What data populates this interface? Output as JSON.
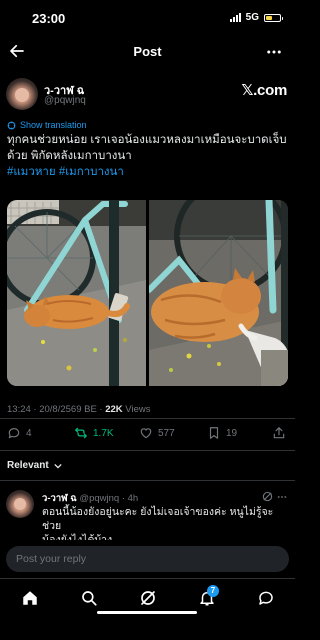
{
  "status_bar": {
    "time": "23:00",
    "network": "5G",
    "battery_color": "#f6d64a"
  },
  "header": {
    "title": "Post"
  },
  "author": {
    "name": "ว-วาฬ ฉ",
    "handle": "@pqwjnq",
    "brand": "𝕏.com"
  },
  "translate": {
    "label": "Show translation"
  },
  "post": {
    "line1": "ทุกคนช่วยหน่อย เราเจอน้องแมวหลงมาเหมือนจะบาดเจ็บ",
    "line2": "ด้วย พิกัดหลังเมกาบางนา",
    "hashtags": [
      "#แมวหาย",
      "#เมกาบางนา"
    ]
  },
  "meta": {
    "timestamp": "13:24 · 20/8/2569 BE · ",
    "views_count": "22K",
    "views_label": " Views"
  },
  "actions": {
    "replies": "4",
    "reposts": "1.7K",
    "likes": "577",
    "bookmarks": "19"
  },
  "sort": {
    "label": "Relevant"
  },
  "reply": {
    "name": "ว-วาฬ ฉ",
    "handle": "@pqwjnq",
    "time": "· 4h",
    "line1": "ตอนนี้น้องยังอยู่นะคะ ยังไม่เจอเจ้าของค่ะ หนูไม่รู้จะช่วย",
    "line2": "น้องยังไงได้บ้าง"
  },
  "composer": {
    "placeholder": "Post your reply"
  },
  "nav": {
    "notification_count": "7"
  },
  "colors": {
    "accent": "#1d9bf0",
    "repost": "#00ba7c",
    "muted": "#71767b"
  }
}
